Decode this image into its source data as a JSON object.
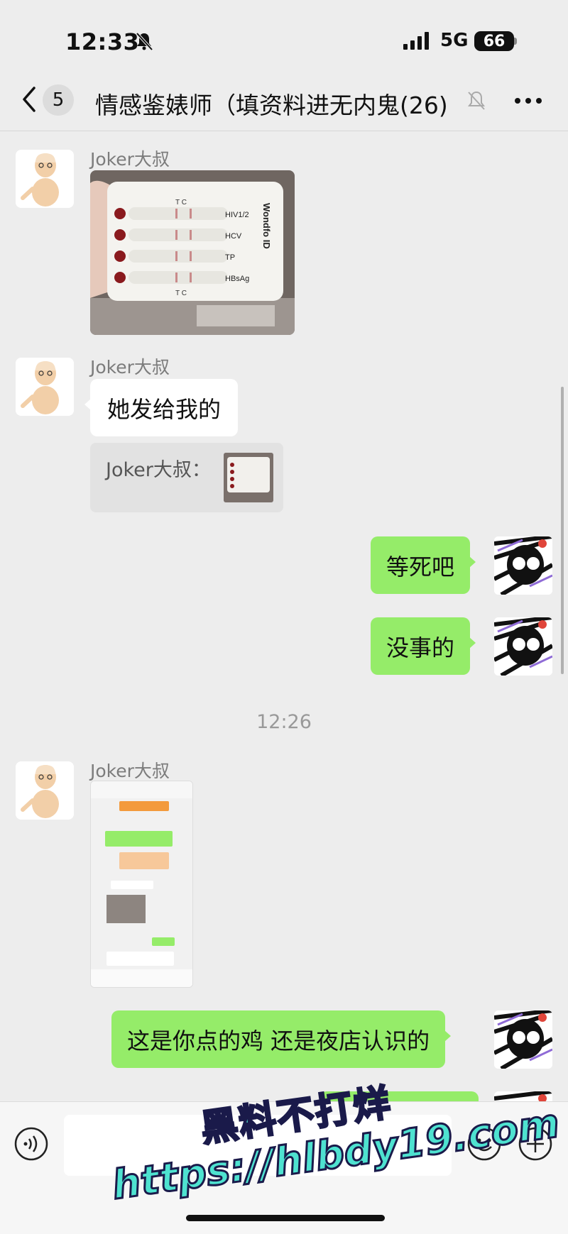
{
  "status": {
    "time": "12:33",
    "network": "5G",
    "battery": "66"
  },
  "header": {
    "back_count": "5",
    "title": "情感鉴婊师（填资料进无内鬼",
    "member_count": "(26)"
  },
  "messages": [
    {
      "sender": "Joker大叔",
      "type": "image",
      "image_label": "HIV1/2 HCV TP HBsAg test card"
    },
    {
      "sender": "Joker大叔",
      "type": "text",
      "text": "她发给我的",
      "quote_label": "Joker大叔："
    },
    {
      "sender": "self",
      "type": "text",
      "text": "等死吧"
    },
    {
      "sender": "self",
      "type": "text",
      "text": "没事的"
    },
    {
      "sender": "Joker大叔",
      "type": "image",
      "image_label": "chat screenshot"
    },
    {
      "sender": "self",
      "type": "text",
      "text": "这是你点的鸡 还是夜店认识的"
    }
  ],
  "timestamp": "12:26",
  "test_card": {
    "tc_top": "T C",
    "rows": [
      "HIV1/2",
      "HCV",
      "TP",
      "HBsAg"
    ],
    "brand": "Wondfo ID",
    "tc_bottom": "T C"
  },
  "watermark": {
    "line1": "黑料不打烊",
    "line2": "https://hlbdy19.com"
  },
  "colors": {
    "background": "#ededed",
    "outgoing_bubble": "#95ec69",
    "incoming_bubble": "#ffffff"
  }
}
